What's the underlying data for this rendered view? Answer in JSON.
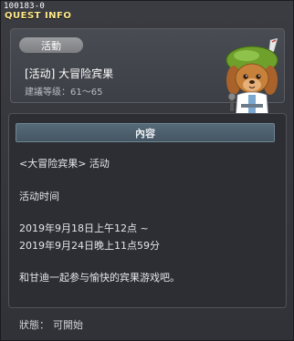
{
  "window": {
    "id": "100183-0",
    "title": "QUEST INFO"
  },
  "quest": {
    "type_badge": "活動",
    "name": "[活动] 大冒险宾果",
    "level_label": "建議等级：61～65"
  },
  "npc": {
    "icon": "dog-npc-avatar-icon",
    "colors": {
      "hat": "#6fa02c",
      "fur": "#c8813a",
      "coat": "#ffffff"
    }
  },
  "content": {
    "header": "內容",
    "lines": [
      "<大冒险宾果> 活动",
      "活动时间",
      "2019年9月18日上午12点 ~",
      "2019年9月24日晚上11点59分",
      "和甘迪一起参与愉快的宾果游戏吧。"
    ]
  },
  "status": {
    "label": "狀態：",
    "value": "可開始"
  },
  "colors": {
    "title": "#ffe98a",
    "header_bar": "#566a78",
    "badge": "#8a8c90"
  }
}
